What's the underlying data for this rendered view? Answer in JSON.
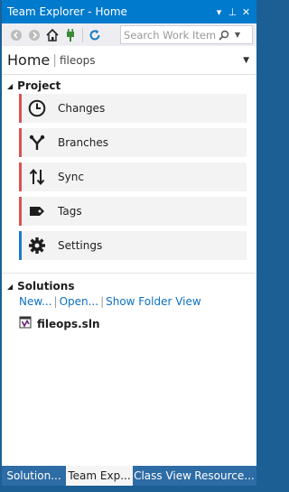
{
  "window": {
    "title": "Team Explorer - Home",
    "buttons": [
      "▾",
      "⊥",
      "✕"
    ]
  },
  "toolbar": {
    "icons": [
      "back-icon",
      "forward-icon",
      "home-icon",
      "connect-icon",
      "refresh-icon"
    ],
    "search_placeholder": "Search Work Items (C"
  },
  "header": {
    "page": "Home",
    "separator": "|",
    "repo": "fileops"
  },
  "project": {
    "heading": "Project",
    "tiles": [
      {
        "label": "Changes",
        "icon": "clock-icon",
        "accent": "#d9534f"
      },
      {
        "label": "Branches",
        "icon": "branch-icon",
        "accent": "#d9534f"
      },
      {
        "label": "Sync",
        "icon": "sync-arrows-icon",
        "accent": "#d9534f"
      },
      {
        "label": "Tags",
        "icon": "tag-icon",
        "accent": "#d9534f"
      },
      {
        "label": "Settings",
        "icon": "gear-icon",
        "accent": "#1e7ac4"
      }
    ]
  },
  "solutions": {
    "heading": "Solutions",
    "links": [
      "New...",
      "Open...",
      "Show Folder View"
    ],
    "link_separator": "|",
    "file": "fileops.sln"
  },
  "tabs": [
    {
      "label": "Solution...",
      "active": false
    },
    {
      "label": "Team Exp...",
      "active": true
    },
    {
      "label": "Class View",
      "active": false
    },
    {
      "label": "Resource...",
      "active": false
    }
  ],
  "colors": {
    "titlebar": "#007acc",
    "link": "#0e70c0",
    "tabbar": "#2d6ca5"
  }
}
